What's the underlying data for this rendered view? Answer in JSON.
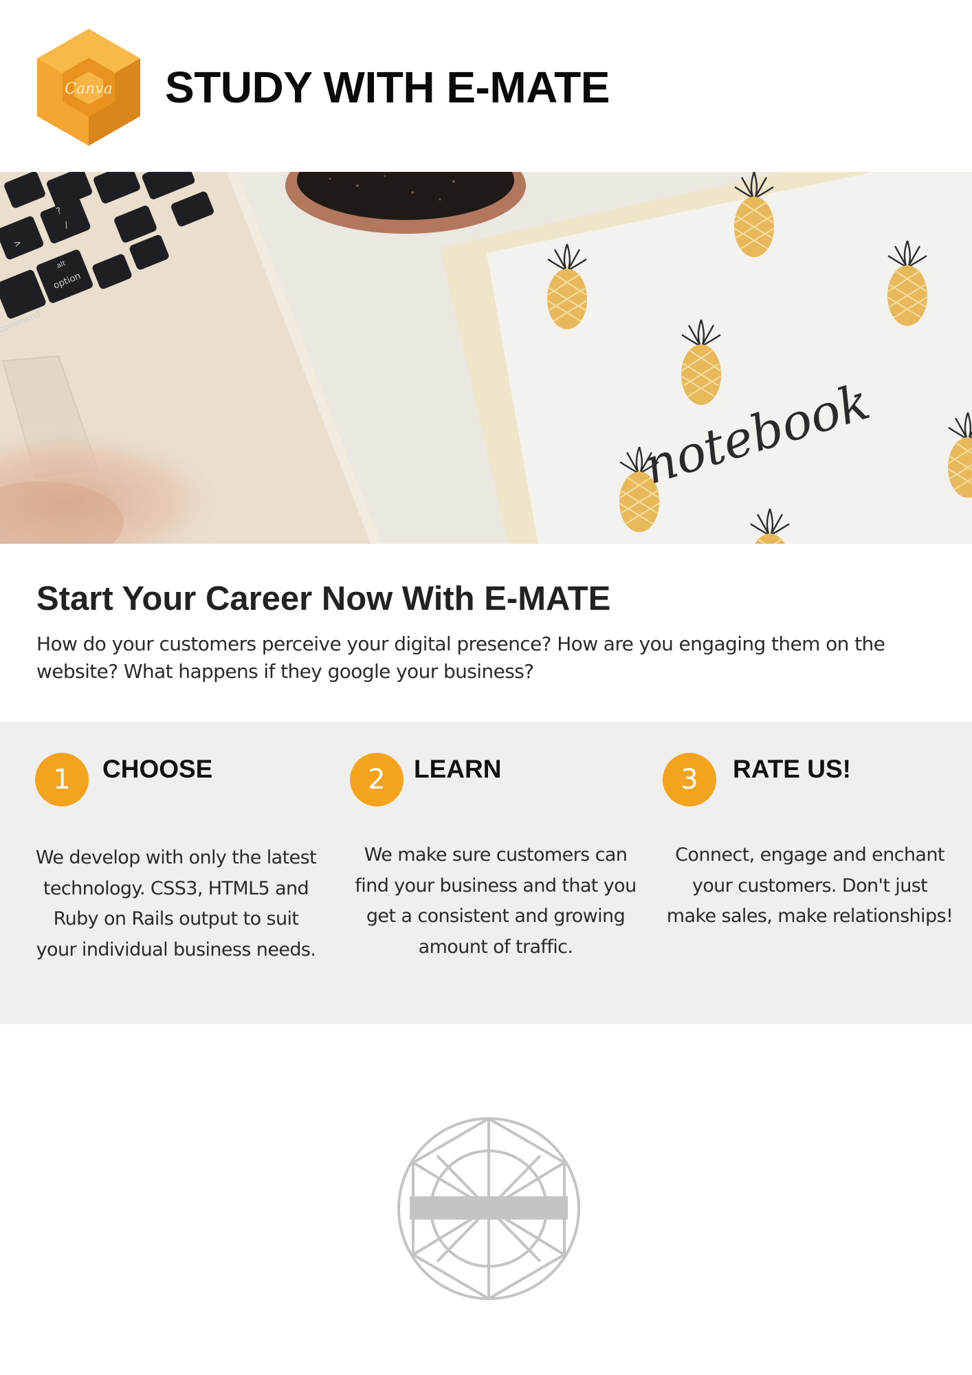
{
  "header": {
    "logo_text": "Canva",
    "title": "STUDY WITH E-MATE"
  },
  "hero": {
    "keyboard_keys": [
      "?",
      "/",
      ">",
      "alt",
      "option",
      "command"
    ],
    "notebook_script": "notebook"
  },
  "intro": {
    "heading": "Start Your Career Now With E-MATE",
    "body": "How do your customers perceive your digital presence? How are you engaging them on the website? What happens if they google your business?"
  },
  "steps": [
    {
      "number": "1",
      "title": "CHOOSE",
      "description": "We develop with only the latest technology. CSS3, HTML5 and Ruby on Rails output to suit your individual business needs."
    },
    {
      "number": "2",
      "title": "LEARN",
      "description": "We make sure customers can find your business and that you get a consistent and growing amount of traffic."
    },
    {
      "number": "3",
      "title": "RATE US!",
      "description": "Connect, engage and enchant your customers. Don't just make sales, make relationships!"
    }
  ],
  "colors": {
    "accent": "#f3a41c",
    "steps_background": "#efeff0",
    "emblem": "#c5c3c3"
  }
}
